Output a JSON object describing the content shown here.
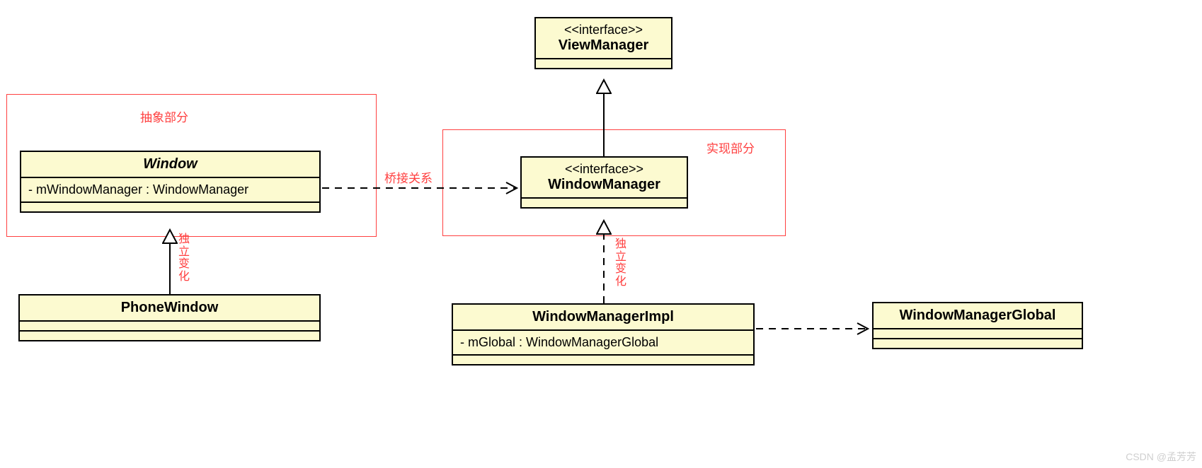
{
  "classes": {
    "viewManager": {
      "stereotype": "<<interface>>",
      "name": "ViewManager"
    },
    "windowManager": {
      "stereotype": "<<interface>>",
      "name": "WindowManager"
    },
    "window": {
      "name": "Window",
      "member": "- mWindowManager : WindowManager"
    },
    "phoneWindow": {
      "name": "PhoneWindow"
    },
    "windowManagerImpl": {
      "name": "WindowManagerImpl",
      "member": "- mGlobal : WindowManagerGlobal"
    },
    "windowManagerGlobal": {
      "name": "WindowManagerGlobal"
    }
  },
  "regions": {
    "abstract": "抽象部分",
    "implement": "实现部分"
  },
  "labels": {
    "bridge": "桥接关系",
    "independent": "独立变化"
  },
  "watermark": "CSDN @孟芳芳"
}
